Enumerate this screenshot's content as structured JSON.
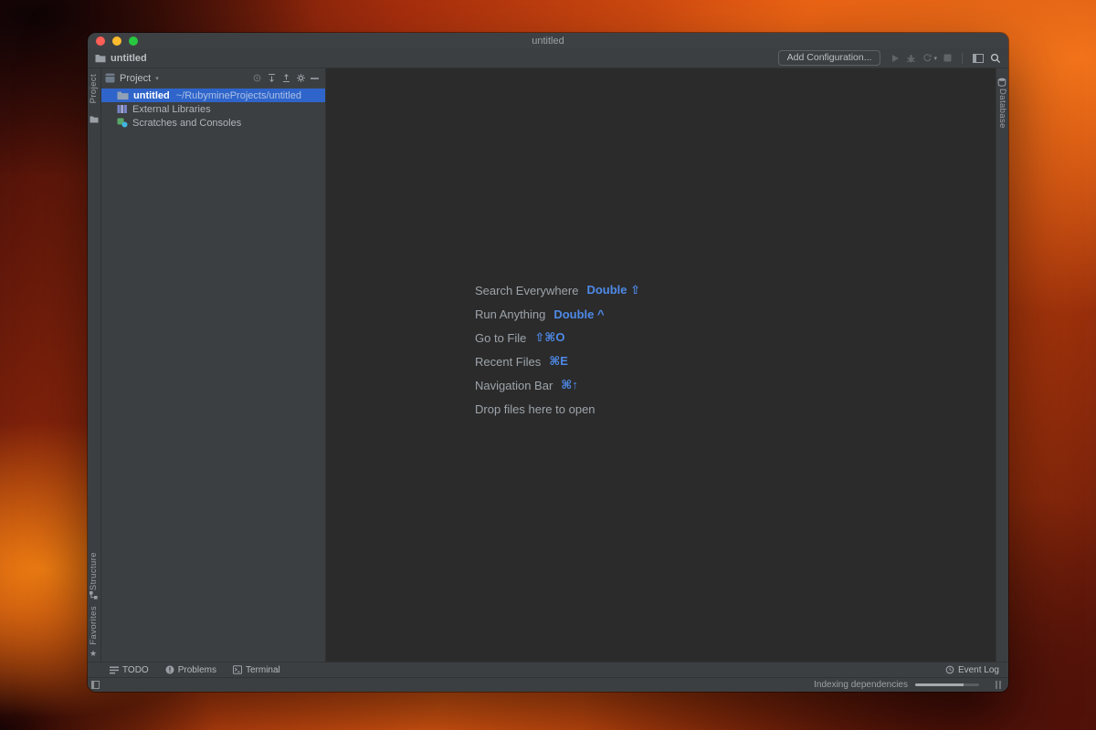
{
  "window": {
    "title": "untitled",
    "toolbar": {
      "breadcrumb": "untitled",
      "add_configuration": "Add Configuration..."
    },
    "left_stripe": {
      "project": "Project",
      "structure": "Structure",
      "favorites": "Favorites"
    },
    "right_stripe": {
      "database": "Database"
    },
    "project_panel": {
      "header": "Project",
      "tree": [
        {
          "name": "untitled",
          "path": "~/RubymineProjects/untitled",
          "icon": "folder",
          "selected": true
        },
        {
          "name": "External Libraries",
          "path": "",
          "icon": "libraries",
          "selected": false
        },
        {
          "name": "Scratches and Consoles",
          "path": "",
          "icon": "scratches",
          "selected": false
        }
      ]
    },
    "editor_hints": [
      {
        "label": "Search Everywhere",
        "shortcut": "Double ⇧"
      },
      {
        "label": "Run Anything",
        "shortcut": "Double ^"
      },
      {
        "label": "Go to File",
        "shortcut": "⇧⌘O"
      },
      {
        "label": "Recent Files",
        "shortcut": "⌘E"
      },
      {
        "label": "Navigation Bar",
        "shortcut": "⌘↑"
      },
      {
        "label": "Drop files here to open",
        "shortcut": ""
      }
    ],
    "bottom_bar": {
      "items": [
        {
          "label": "TODO",
          "icon": "todo"
        },
        {
          "label": "Problems",
          "icon": "problems"
        },
        {
          "label": "Terminal",
          "icon": "terminal"
        }
      ],
      "event_log": "Event Log"
    },
    "status_bar": {
      "text": "Indexing dependencies",
      "progress": 0.75
    }
  },
  "colors": {
    "selection_blue": "#2f65ca",
    "shortcut_blue": "#4e8ae8",
    "panel_bg": "#3c3f41",
    "editor_bg": "#2b2b2b",
    "traffic_red": "#ff5f57",
    "traffic_yellow": "#febc2e",
    "traffic_green": "#28c840"
  }
}
